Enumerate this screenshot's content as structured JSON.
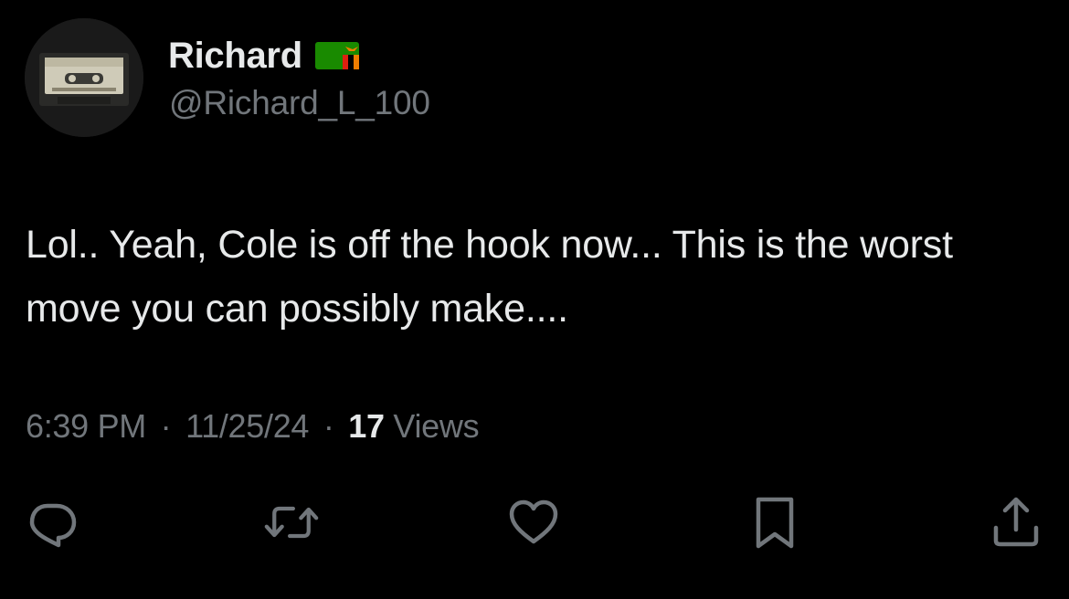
{
  "author": {
    "display_name": "Richard",
    "handle": "@Richard_L_100",
    "flag_icon": "zambia-flag-icon",
    "avatar_icon": "cassette-tape-avatar"
  },
  "tweet": {
    "text": "Lol.. Yeah, Cole is off the hook now... This is the worst move you can possibly make...."
  },
  "meta": {
    "time": "6:39 PM",
    "separator": "·",
    "date": "11/25/24",
    "views_count": "17",
    "views_label": "Views"
  },
  "actions": [
    {
      "name": "reply",
      "icon": "reply-icon"
    },
    {
      "name": "repost",
      "icon": "repost-icon"
    },
    {
      "name": "like",
      "icon": "heart-icon"
    },
    {
      "name": "bookmark",
      "icon": "bookmark-icon"
    },
    {
      "name": "share",
      "icon": "share-icon"
    }
  ],
  "colors": {
    "background": "#000000",
    "primary_text": "#e7e9ea",
    "secondary_text": "#71767b",
    "icon": "#71767b"
  }
}
